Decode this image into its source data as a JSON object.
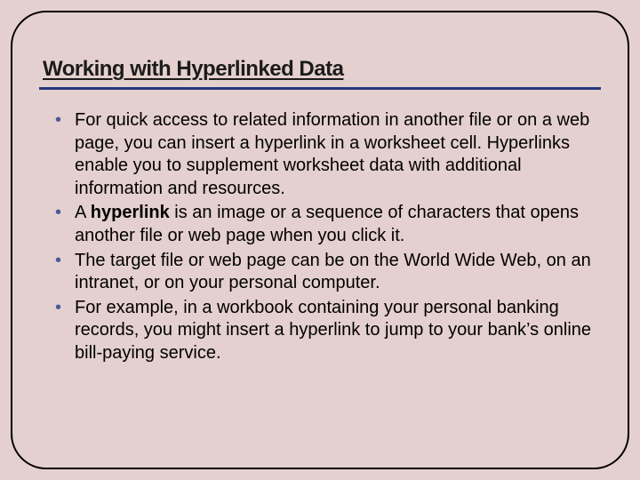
{
  "slide": {
    "title": "Working with Hyperlinked Data",
    "bullets": [
      {
        "pre": "For quick access to related information in another file or on a web page, you can insert a hyperlink in a worksheet cell. Hyperlinks enable you to supplement worksheet data with additional information and resources.",
        "bold": "",
        "post": ""
      },
      {
        "pre": "A ",
        "bold": "hyperlink",
        "post": " is an image or a sequence of characters that opens another file or web page when you click it."
      },
      {
        "pre": "The target file or web page can be on the World Wide Web, on an intranet, or on your personal computer.",
        "bold": "",
        "post": ""
      },
      {
        "pre": "For example, in a workbook containing your personal banking records, you might insert a hyperlink to jump to your bank’s online bill-paying service.",
        "bold": "",
        "post": ""
      }
    ]
  }
}
